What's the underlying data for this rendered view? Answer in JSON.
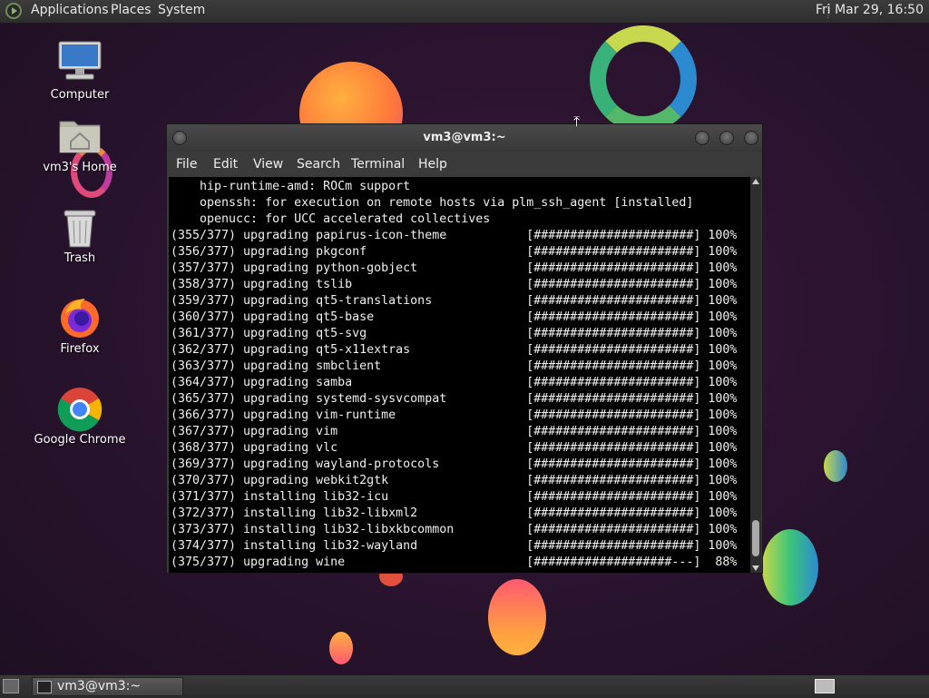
{
  "top_panel": {
    "menus": [
      "Applications",
      "Places",
      "System"
    ],
    "clock": "Fri Mar 29, 16:50"
  },
  "desktop_icons": [
    {
      "label": "Computer",
      "icon": "computer-icon"
    },
    {
      "label": "vm3's Home",
      "icon": "home-folder-icon"
    },
    {
      "label": "Trash",
      "icon": "trash-icon"
    },
    {
      "label": "Firefox",
      "icon": "firefox-icon"
    },
    {
      "label": "Google Chrome",
      "icon": "chrome-icon"
    }
  ],
  "terminal": {
    "title": "vm3@vm3:~",
    "menu": [
      "File",
      "Edit",
      "View",
      "Search",
      "Terminal",
      "Help"
    ],
    "lines": [
      "    hip-runtime-amd: ROCm support",
      "    openssh: for execution on remote hosts via plm_ssh_agent [installed]",
      "    openucc: for UCC accelerated collectives",
      "(355/377) upgrading papirus-icon-theme           [######################] 100%",
      "(356/377) upgrading pkgconf                      [######################] 100%",
      "(357/377) upgrading python-gobject               [######################] 100%",
      "(358/377) upgrading tslib                        [######################] 100%",
      "(359/377) upgrading qt5-translations             [######################] 100%",
      "(360/377) upgrading qt5-base                     [######################] 100%",
      "(361/377) upgrading qt5-svg                      [######################] 100%",
      "(362/377) upgrading qt5-x11extras                [######################] 100%",
      "(363/377) upgrading smbclient                    [######################] 100%",
      "(364/377) upgrading samba                        [######################] 100%",
      "(365/377) upgrading systemd-sysvcompat           [######################] 100%",
      "(366/377) upgrading vim-runtime                  [######################] 100%",
      "(367/377) upgrading vim                          [######################] 100%",
      "(368/377) upgrading vlc                          [######################] 100%",
      "(369/377) upgrading wayland-protocols            [######################] 100%",
      "(370/377) upgrading webkit2gtk                   [######################] 100%",
      "(371/377) installing lib32-icu                   [######################] 100%",
      "(372/377) installing lib32-libxml2               [######################] 100%",
      "(373/377) installing lib32-libxkbcommon          [######################] 100%",
      "(374/377) installing lib32-wayland               [######################] 100%",
      "(375/377) upgrading wine                         [###################---]  88%"
    ]
  },
  "taskbar": {
    "tasks": [
      {
        "label": "vm3@vm3:~",
        "icon": "terminal-icon"
      }
    ]
  },
  "colors": {
    "panel": "#333333",
    "desktop_bg": "#2b1430",
    "terminal_bg": "#000000",
    "terminal_fg": "#f0f0f0"
  }
}
